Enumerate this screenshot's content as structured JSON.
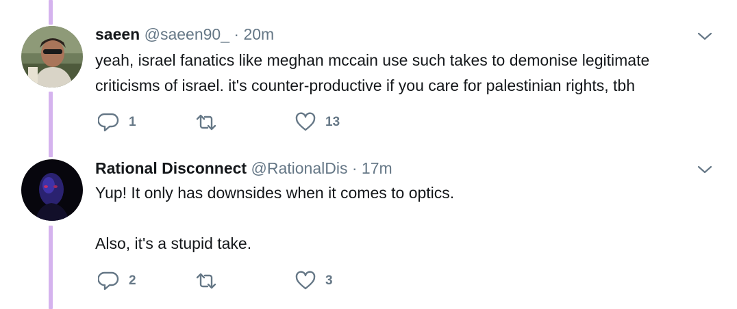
{
  "tweets": [
    {
      "display_name": "saeen",
      "handle": "@saeen90_",
      "separator": "·",
      "time": "20m",
      "text": [
        "yeah, israel fanatics like meghan mccain use such takes to demonise legitimate criticisms of israel. it's counter-productive if you care for palestinian rights, tbh"
      ],
      "replies": "1",
      "retweets": "",
      "likes": "13",
      "icons": {
        "reply": "reply-icon",
        "retweet": "retweet-icon",
        "like": "heart-icon",
        "menu": "chevron-down-icon"
      }
    },
    {
      "display_name": "Rational Disconnect",
      "handle": "@RationalDis",
      "separator": "·",
      "time": "17m",
      "text": [
        "Yup! It only has downsides when it comes to optics.",
        "Also, it's a stupid take."
      ],
      "replies": "2",
      "retweets": "",
      "likes": "3",
      "icons": {
        "reply": "reply-icon",
        "retweet": "retweet-icon",
        "like": "heart-icon",
        "menu": "chevron-down-icon"
      }
    }
  ],
  "colors": {
    "thread_line": "#d5b3ee",
    "text": "#14171a",
    "secondary": "#657786"
  }
}
